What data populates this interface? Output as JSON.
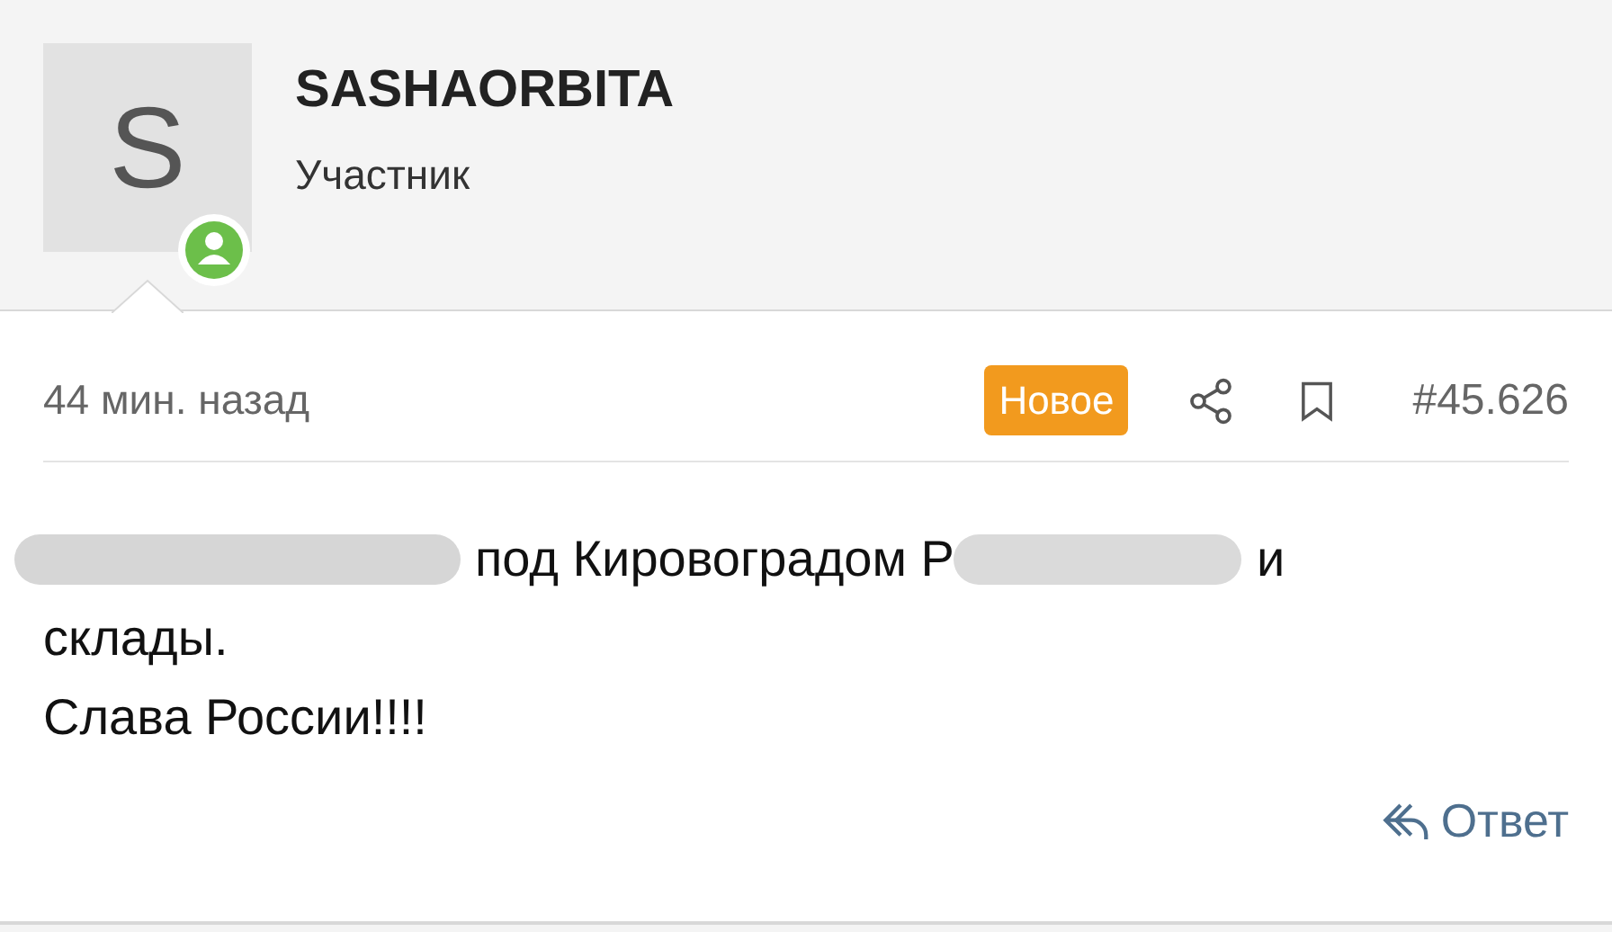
{
  "author": {
    "avatar_letter": "S",
    "online": true,
    "name": "SASHAORBITA",
    "role": "Участник"
  },
  "post": {
    "time": "44 мин. назад",
    "badge": "Новое",
    "number": "#45.626",
    "body": [
      {
        "parts": [
          {
            "kind": "redacted"
          },
          {
            "kind": "text",
            "text": "под Кировоградом Р"
          },
          {
            "kind": "redacted"
          },
          {
            "kind": "text",
            "text": "и"
          }
        ]
      },
      {
        "parts": [
          {
            "kind": "text",
            "text": "склады."
          }
        ]
      },
      {
        "parts": [
          {
            "kind": "text",
            "text": "Слава России!!!!"
          }
        ]
      }
    ],
    "reply": "Ответ"
  }
}
